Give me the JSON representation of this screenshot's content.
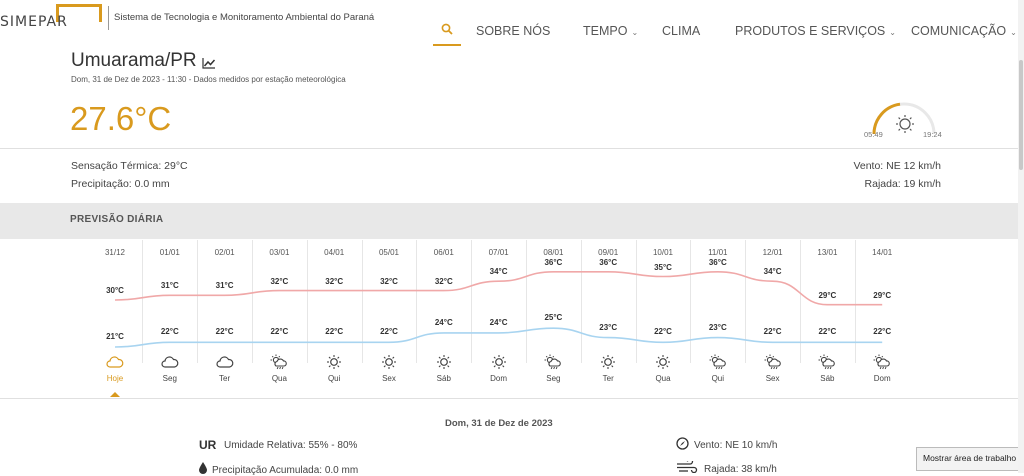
{
  "brand": {
    "logo_text": "SIMEPAR",
    "tagline": "Sistema de Tecnologia e Monitoramento Ambiental do Paraná",
    "accent": "#d99a1e"
  },
  "nav": {
    "items": [
      {
        "label": "SOBRE NÓS",
        "dropdown": false
      },
      {
        "label": "TEMPO",
        "dropdown": true
      },
      {
        "label": "CLIMA",
        "dropdown": false
      },
      {
        "label": "PRODUTOS E SERVIÇOS",
        "dropdown": true
      },
      {
        "label": "COMUNICAÇÃO",
        "dropdown": true
      }
    ]
  },
  "station": {
    "city": "Umuarama/PR",
    "meta": "Dom, 31 de Dez de 2023 - 11:30 - Dados medidos por estação meteorológica",
    "temperature": "27.6°C",
    "sunrise": "05:49",
    "sunset": "19:24",
    "sensation": "Sensação Térmica: 29°C",
    "precipitation": "Precipitação: 0.0 mm",
    "wind": "Vento: NE 12 km/h",
    "gust": "Rajada: 19 km/h"
  },
  "forecast": {
    "title": "PREVISÃO DIÁRIA",
    "max_color": "#f0a8a8",
    "min_color": "#a8d4f0",
    "days": [
      {
        "date": "31/12",
        "name": "Hoje",
        "max": 30,
        "min": 21,
        "icon": "cloudy-icon"
      },
      {
        "date": "01/01",
        "name": "Seg",
        "max": 31,
        "min": 22,
        "icon": "cloudy-icon"
      },
      {
        "date": "02/01",
        "name": "Ter",
        "max": 31,
        "min": 22,
        "icon": "cloudy-icon"
      },
      {
        "date": "03/01",
        "name": "Qua",
        "max": 32,
        "min": 22,
        "icon": "sun-rain-icon"
      },
      {
        "date": "04/01",
        "name": "Qui",
        "max": 32,
        "min": 22,
        "icon": "sun-icon"
      },
      {
        "date": "05/01",
        "name": "Sex",
        "max": 32,
        "min": 22,
        "icon": "sun-icon"
      },
      {
        "date": "06/01",
        "name": "Sáb",
        "max": 32,
        "min": 24,
        "icon": "sun-icon"
      },
      {
        "date": "07/01",
        "name": "Dom",
        "max": 34,
        "min": 24,
        "icon": "sun-icon"
      },
      {
        "date": "08/01",
        "name": "Seg",
        "max": 36,
        "min": 25,
        "icon": "sun-rain-icon"
      },
      {
        "date": "09/01",
        "name": "Ter",
        "max": 36,
        "min": 23,
        "icon": "sun-icon"
      },
      {
        "date": "10/01",
        "name": "Qua",
        "max": 35,
        "min": 22,
        "icon": "sun-icon"
      },
      {
        "date": "11/01",
        "name": "Qui",
        "max": 36,
        "min": 23,
        "icon": "sun-rain-icon"
      },
      {
        "date": "12/01",
        "name": "Sex",
        "max": 34,
        "min": 22,
        "icon": "sun-rain-icon"
      },
      {
        "date": "13/01",
        "name": "Sáb",
        "max": 29,
        "min": 22,
        "icon": "sun-rain-icon"
      },
      {
        "date": "14/01",
        "name": "Dom",
        "max": 29,
        "min": 22,
        "icon": "sun-rain-icon"
      }
    ]
  },
  "selected_day": {
    "date": "Dom, 31 de Dez de 2023",
    "ur_label": "UR",
    "humidity": "Umidade Relativa: 55% - 80%",
    "precip_acc": "Precipitação Acumulada: 0.0 mm",
    "wind": "Vento: NE 10 km/h",
    "gust": "Rajada: 38 km/h"
  },
  "tooltip": "Mostrar área de trabalho"
}
